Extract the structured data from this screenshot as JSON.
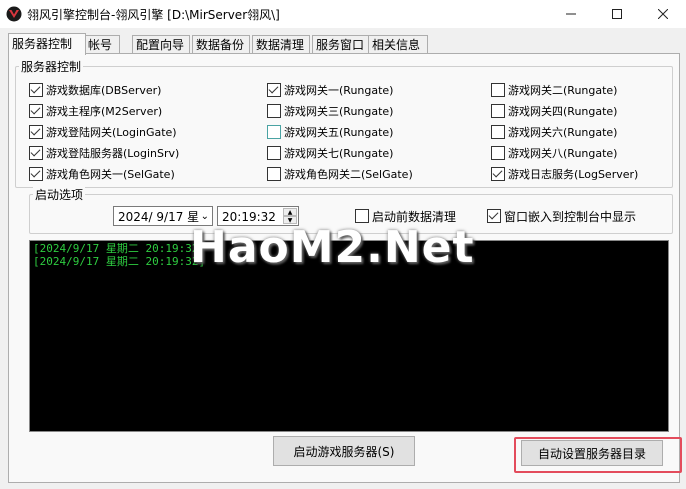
{
  "window": {
    "title": "翎风引擎控制台-翎风引擎 [D:\\MirServer翎风\\]",
    "accent": "#c0392b"
  },
  "tabs": [
    {
      "label": "服务器控制",
      "active": true
    },
    {
      "label": "帐号"
    },
    {
      "label": "配置向导"
    },
    {
      "label": "数据备份"
    },
    {
      "label": "数据清理"
    },
    {
      "label": "服务窗口"
    },
    {
      "label": "相关信息"
    }
  ],
  "server_group": {
    "label": "服务器控制",
    "checkboxes": [
      {
        "label": "游戏数据库(DBServer)",
        "checked": true
      },
      {
        "label": "游戏主程序(M2Server)",
        "checked": true
      },
      {
        "label": "游戏登陆网关(LoginGate)",
        "checked": true
      },
      {
        "label": "游戏登陆服务器(LoginSrv)",
        "checked": true
      },
      {
        "label": "游戏角色网关一(SelGate)",
        "checked": true
      },
      {
        "label": "游戏网关一(Rungate)",
        "checked": true
      },
      {
        "label": "游戏网关三(Rungate)",
        "checked": false
      },
      {
        "label": "游戏网关五(Rungate)",
        "checked": false
      },
      {
        "label": "游戏网关七(Rungate)",
        "checked": false
      },
      {
        "label": "游戏角色网关二(SelGate)",
        "checked": false
      },
      {
        "label": "游戏网关二(Rungate)",
        "checked": false
      },
      {
        "label": "游戏网关四(Rungate)",
        "checked": false
      },
      {
        "label": "游戏网关六(Rungate)",
        "checked": false
      },
      {
        "label": "游戏网关八(Rungate)",
        "checked": false
      },
      {
        "label": "游戏日志服务(LogServer)",
        "checked": true
      }
    ]
  },
  "startup_group": {
    "label": "启动选项",
    "date_value": "2024/ 9/17 星",
    "time_value": "20:19:32",
    "clear_before_start": {
      "label": "启动前数据清理",
      "checked": false
    },
    "embed_window": {
      "label": "窗口嵌入到控制台中显示",
      "checked": true
    }
  },
  "log": {
    "lines": [
      "[2024/9/17 星期二 20:19:32]",
      "[2024/9/17 星期二 20:19:32]"
    ],
    "text_color": "#2ecc40"
  },
  "watermark": "HaoM2.Net",
  "buttons": {
    "start_server": "启动游戏服务器(S)",
    "auto_set_dir": "自动设置服务器目录"
  }
}
